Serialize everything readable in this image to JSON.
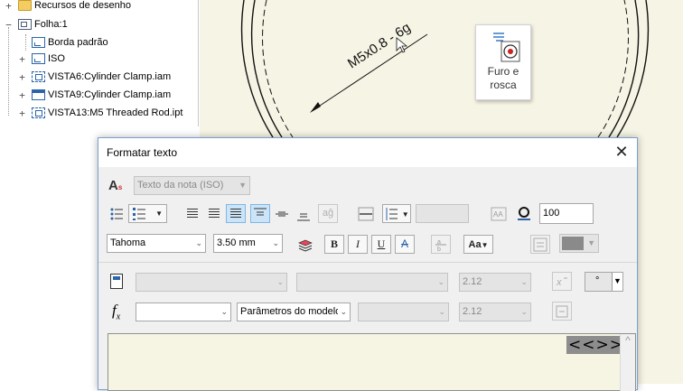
{
  "browser": {
    "items": [
      {
        "label": "Recursos de desenho",
        "expander": "+"
      },
      {
        "label": "Folha:1",
        "expander": "−"
      },
      {
        "label": "Borda padrão",
        "expander": ""
      },
      {
        "label": "ISO",
        "expander": "+"
      },
      {
        "label": "VISTA6:Cylinder Clamp.iam",
        "expander": "+"
      },
      {
        "label": "VISTA9:Cylinder Clamp.iam",
        "expander": "+"
      },
      {
        "label": "VISTA13:M5 Threaded Rod.ipt",
        "expander": "+"
      }
    ]
  },
  "canvas": {
    "thread_note": "M5x0.8 - 6g",
    "tooltip": {
      "line1": "Furo e",
      "line2": "rosca",
      "icon": "hole-thread-icon"
    }
  },
  "dialog": {
    "title": "Formatar texto",
    "close_glyph": "✕",
    "style_combo": "Texto da nota (ISO)",
    "font_combo": "Tahoma",
    "size_combo": "3.50 mm",
    "width_percent": "100",
    "bold": "B",
    "italic": "I",
    "underline": "U",
    "strike": "A",
    "indent_label": "aĝ",
    "param_combo": "Parâmetros do modelo",
    "precision_1": "2.12",
    "precision_2": "2.12",
    "symbol_value": "°",
    "fx_label": "f",
    "fx_sub": "x",
    "text_token": "<<>>",
    "scroll_glyph": "^",
    "colors": {
      "selected": "#cce4f7",
      "text_bg": "#f6f5e3",
      "token_bg": "#8d8d8d"
    }
  }
}
